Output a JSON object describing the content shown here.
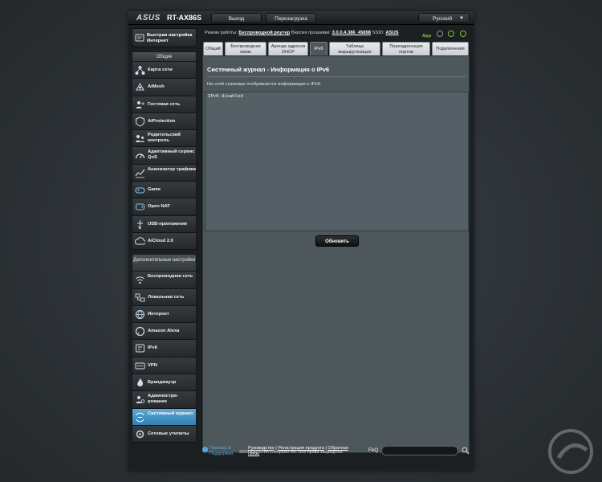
{
  "header": {
    "logo": "ASUS",
    "model": "RT-AX86S",
    "logout_label": "Выход",
    "reboot_label": "Перезагрузка",
    "language": "Русский"
  },
  "sidebar": {
    "quick_setup": "Быстрая настройка Интернет",
    "general_header": "Общие",
    "general_items": [
      {
        "label": "Карта сети",
        "icon": "network-map-icon"
      },
      {
        "label": "AiMesh",
        "icon": "aimesh-icon"
      },
      {
        "label": "Гостевая сеть",
        "icon": "guest-network-icon"
      },
      {
        "label": "AiProtection",
        "icon": "aiprotection-icon"
      },
      {
        "label": "Родительский контроль",
        "icon": "parental-control-icon"
      },
      {
        "label": "Адаптивный сервис QoS",
        "icon": "qos-icon"
      },
      {
        "label": "Анализатор трафика",
        "icon": "traffic-analyzer-icon"
      },
      {
        "label": "Game",
        "icon": "game-icon"
      },
      {
        "label": "Open NAT",
        "icon": "open-nat-icon"
      },
      {
        "label": "USB-приложение",
        "icon": "usb-icon"
      },
      {
        "label": "AiCloud 2.0",
        "icon": "aicloud-icon"
      }
    ],
    "advanced_header": "Дополнительные настройки",
    "advanced_items": [
      {
        "label": "Беспроводная сеть",
        "icon": "wireless-icon"
      },
      {
        "label": "Локальная сеть",
        "icon": "lan-icon"
      },
      {
        "label": "Интернет",
        "icon": "internet-icon"
      },
      {
        "label": "Amazon Alexa",
        "icon": "alexa-icon"
      },
      {
        "label": "IPv6",
        "icon": "ipv6-icon"
      },
      {
        "label": "VPN",
        "icon": "vpn-icon"
      },
      {
        "label": "Брандмауэр",
        "icon": "firewall-icon"
      },
      {
        "label": "Администри- рование",
        "icon": "administration-icon"
      },
      {
        "label": "Системный журнал",
        "icon": "system-log-icon"
      },
      {
        "label": "Сетевые утилиты",
        "icon": "network-tools-icon"
      }
    ]
  },
  "status": {
    "mode_label": "Режим работы:",
    "mode_value": "Беспроводной роутер",
    "firmware_label": "Версия прошивки:",
    "firmware_value": "3.0.0.4.386_45898",
    "ssid_label": "SSID:",
    "ssid_value": "ASUS",
    "app_label": "App"
  },
  "tabs": [
    "Общий",
    "Беспроводная связь",
    "Аренда адресов DHCP",
    "IPv6",
    "Таблица маршрутизации",
    "Переадресация портов",
    "Подключения"
  ],
  "panel": {
    "title": "Системный журнал - Информация о IPv6",
    "description": "На этой странице отображается информация о IPv6.",
    "log_text": "IPv6 disabled",
    "refresh_label": "Обновить"
  },
  "footer": {
    "help": "Помощь & Поддержка",
    "manual": "Руководство",
    "register": "Регистрация продукта",
    "feedback": "Обратная связь",
    "faq": "FAQ",
    "copyright": "2020 ASUSTeK Computer Inc. Все права защищены."
  },
  "colors": {
    "active_nav": "#2f7fb3",
    "accent_green": "#7fbf3f",
    "help_blue": "#58a9d8"
  }
}
